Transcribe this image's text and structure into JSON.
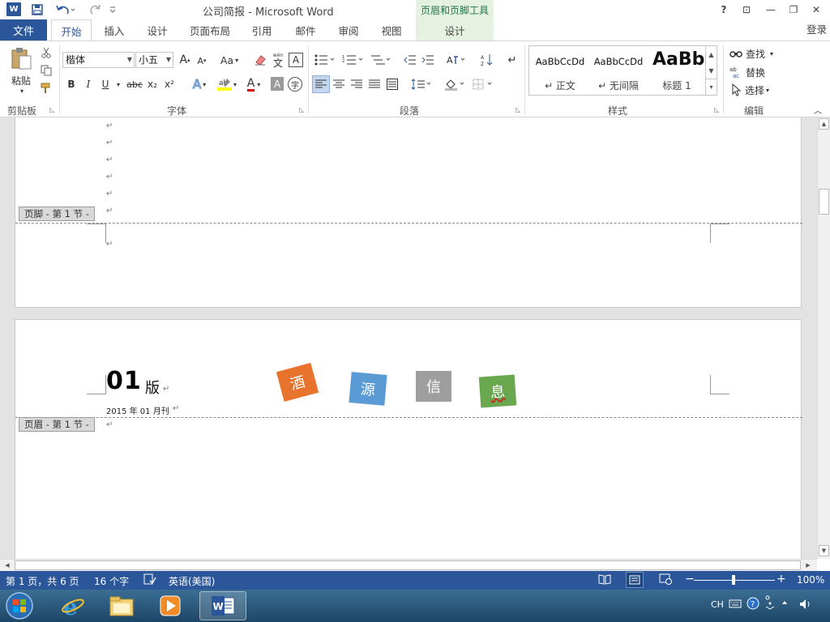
{
  "titlebar": {
    "word_logo": "W",
    "title": "公司简报 - Microsoft Word",
    "context_tools": "页眉和页脚工具",
    "help": "?",
    "restore_ribbon": "⊡",
    "minimize": "—",
    "maximize": "❐",
    "close": "✕"
  },
  "tabs": {
    "file": "文件",
    "home": "开始",
    "insert": "插入",
    "design": "设计",
    "layout": "页面布局",
    "references": "引用",
    "mailings": "邮件",
    "review": "审阅",
    "view": "视图",
    "hf_design": "设计",
    "login": "登录"
  },
  "ribbon": {
    "clipboard": {
      "paste": "粘贴",
      "label": "剪贴板"
    },
    "font": {
      "font_name": "楷体",
      "font_size": "小五",
      "grow": "A",
      "shrink": "A",
      "case": "Aa",
      "pinyin": "wén",
      "bold": "B",
      "italic": "I",
      "underline": "U",
      "strike": "abc",
      "subscript": "x₂",
      "superscript": "x²",
      "font_color": "A",
      "char_shade": "A",
      "enclose": "字",
      "label": "字体"
    },
    "paragraph": {
      "label": "段落"
    },
    "styles": {
      "items": [
        {
          "preview": "AaBbCcDd",
          "name": "↵ 正文"
        },
        {
          "preview": "AaBbCcDd",
          "name": "↵ 无间隔"
        },
        {
          "preview": "AaBb",
          "name": "标题 1"
        }
      ],
      "label": "样式"
    },
    "editing": {
      "find": "查找",
      "replace": "替换",
      "select": "选择",
      "label": "编辑"
    }
  },
  "document": {
    "para_mark": "↵",
    "footer_tag": "页脚 - 第 1 节 -",
    "header_tag": "页眉 - 第 1 节 -",
    "issue_number": "01",
    "issue_suffix": "版",
    "issue_date": "2015 年 01 月刊",
    "tiles": [
      {
        "char": "酒",
        "color": "#e8732c"
      },
      {
        "char": "源",
        "color": "#5b9bd5"
      },
      {
        "char": "信",
        "color": "#9e9e9e"
      },
      {
        "char": "息",
        "color": "#6aa84f"
      }
    ]
  },
  "statusbar": {
    "page": "第 1 页，共 6 页",
    "words": "16 个字",
    "language": "英语(美国)",
    "zoom": "100%"
  },
  "taskbar": {
    "ime": "CH"
  }
}
